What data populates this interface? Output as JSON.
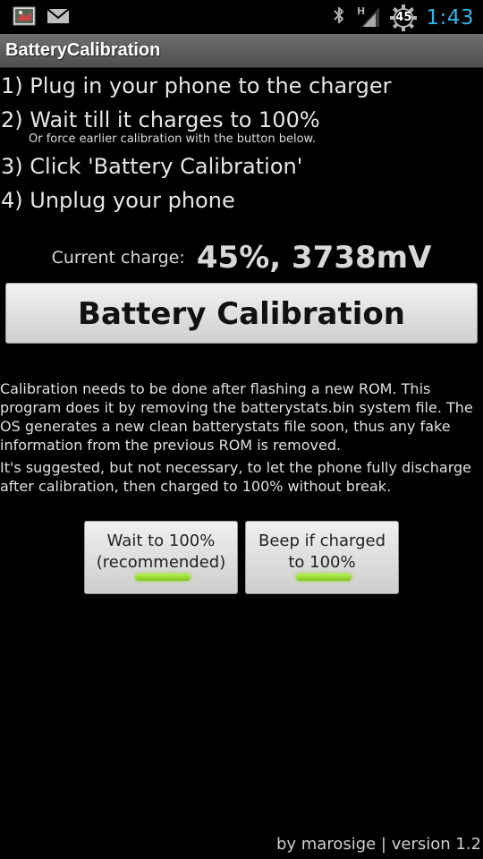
{
  "status_bar": {
    "icons_left": [
      "app-notification-icon",
      "mail-icon"
    ],
    "icons_right": [
      "bluetooth-icon",
      "hspa-signal-icon",
      "battery-percent-gear-icon"
    ],
    "hspa_label": "H",
    "battery_badge": "45",
    "time": "1:43",
    "time_color": "#33b5e5"
  },
  "title_bar": {
    "title": "BatteryCalibration"
  },
  "steps": [
    "1) Plug in your phone to the charger",
    "2) Wait till it charges to 100%",
    "3) Click 'Battery Calibration'",
    "4) Unplug your phone"
  ],
  "step_note": "Or force earlier calibration with the button below.",
  "charge": {
    "label": "Current charge:",
    "value": "45%, 3738mV"
  },
  "calibration_button": {
    "label": "Battery Calibration"
  },
  "info": [
    "Calibration needs to be done after flashing a new ROM. This program does it by removing the batterystats.bin system file. The OS generates a new clean batterystats file soon, thus any fake information from the previous ROM is removed.",
    "It's suggested, but not necessary, to let the phone fully discharge after calibration, then charged to 100% without break."
  ],
  "toggles": {
    "wait": {
      "line1": "Wait to 100%",
      "line2": "(recommended)",
      "checked": true
    },
    "beep": {
      "line1": "Beep if charged",
      "line2": "to 100%",
      "checked": true
    },
    "indicator_color": "#9be03a"
  },
  "footer": "by marosige | version 1.2"
}
